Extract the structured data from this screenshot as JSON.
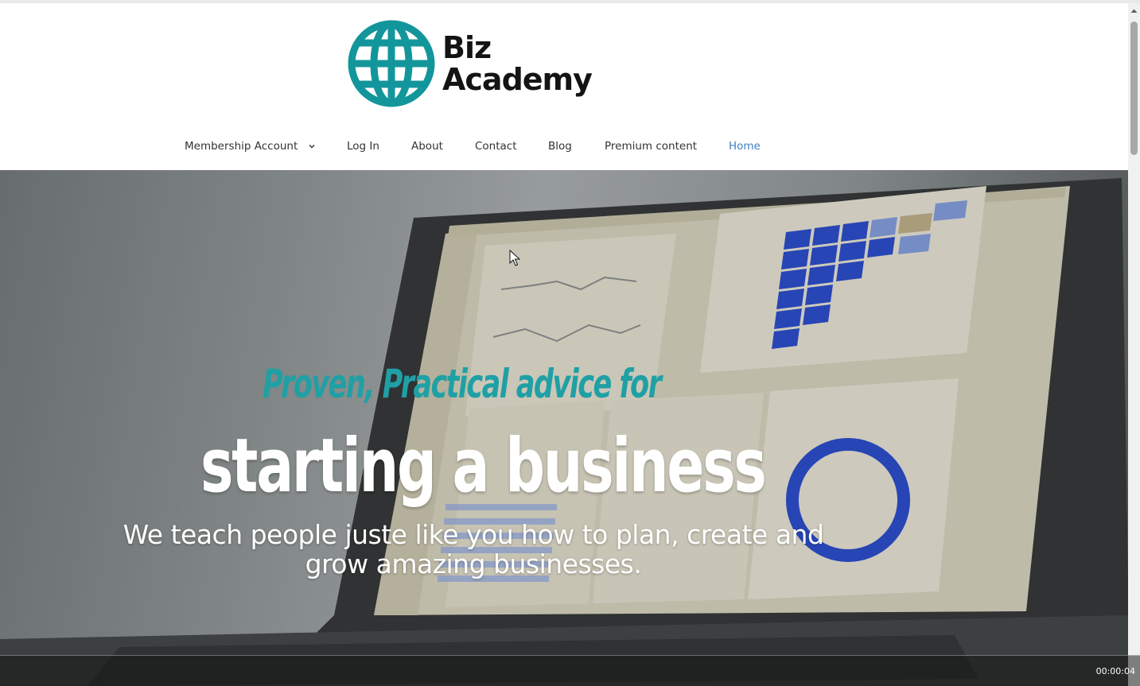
{
  "brand": {
    "name_line1": "Biz",
    "name_line2": "Academy",
    "logo_color": "#13969b"
  },
  "nav": {
    "items": [
      {
        "label": "Membership Account",
        "has_dropdown": true
      },
      {
        "label": "Log In"
      },
      {
        "label": "About"
      },
      {
        "label": "Contact"
      },
      {
        "label": "Blog"
      },
      {
        "label": "Premium content"
      },
      {
        "label": "Home",
        "active": true
      }
    ],
    "active_color": "#3d82c4"
  },
  "hero": {
    "tagline": "Proven, Practical advice for",
    "headline": "starting a business",
    "subtext": "We teach people juste like you how to plan, create and grow amazing businesses.",
    "tagline_color": "#1fa0a5"
  },
  "video": {
    "timestamp": "00:00:04"
  },
  "icons": {
    "globe": "globe-icon",
    "dropdown": "chevron-down-icon",
    "cursor": "mouse-cursor-icon"
  }
}
